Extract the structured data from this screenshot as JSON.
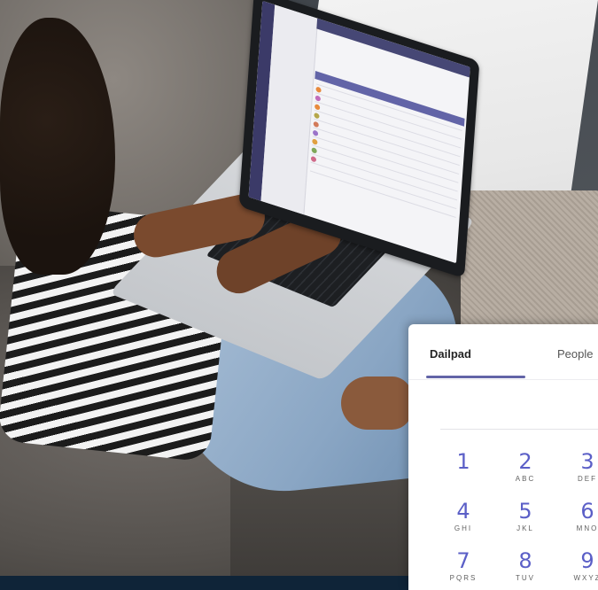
{
  "dialpad": {
    "tabs": [
      {
        "label": "Dailpad",
        "active": true
      },
      {
        "label": "People",
        "active": false
      }
    ],
    "accent_color": "#6264a7",
    "digit_color": "#5b5fc7",
    "keys": [
      {
        "digit": "1",
        "letters": ""
      },
      {
        "digit": "2",
        "letters": "ABC"
      },
      {
        "digit": "3",
        "letters": "DEF"
      },
      {
        "digit": "4",
        "letters": "GHI"
      },
      {
        "digit": "5",
        "letters": "JKL"
      },
      {
        "digit": "6",
        "letters": "MNO"
      },
      {
        "digit": "7",
        "letters": "PQRS"
      },
      {
        "digit": "8",
        "letters": "TUV"
      },
      {
        "digit": "9",
        "letters": "WXYZ"
      }
    ]
  },
  "laptop_app": {
    "rail_color": "#3b3a68",
    "topbar_color": "#464775",
    "highlight_color": "#6264a7"
  }
}
